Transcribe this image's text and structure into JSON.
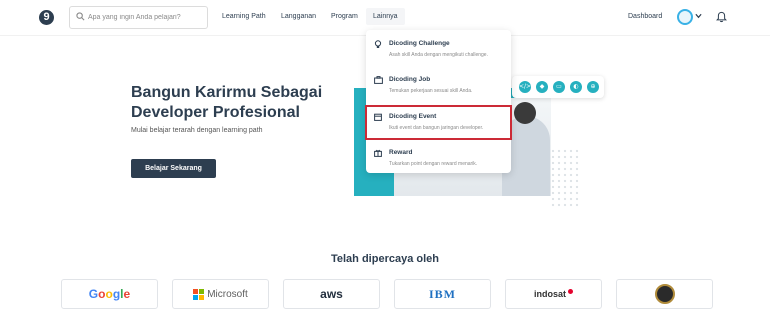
{
  "header": {
    "logo_char": "9",
    "search_placeholder": "Apa yang ingin Anda pelajari?",
    "nav": [
      "Learning Path",
      "Langganan",
      "Program",
      "Lainnya"
    ],
    "dashboard": "Dashboard"
  },
  "hero": {
    "title_line1": "Bangun Karirmu Sebagai",
    "title_line2": "Developer Profesional",
    "subtitle": "Mulai belajar terarah dengan learning path",
    "cta": "Belajar Sekarang",
    "tech_icons": [
      "code-icon",
      "cube-icon",
      "vr-icon",
      "android-icon",
      "globe-icon"
    ]
  },
  "dropdown": {
    "items": [
      {
        "title": "Dicoding Challenge",
        "desc": "Asah skill Anda dengan mengikuti challenge.",
        "icon": "bulb-icon"
      },
      {
        "title": "Dicoding Job",
        "desc": "Temukan pekerjaan sesuai skill Anda.",
        "icon": "briefcase-icon"
      },
      {
        "title": "Dicoding Event",
        "desc": "Ikuti event dan bangun jaringan developer.",
        "icon": "calendar-icon"
      },
      {
        "title": "Reward",
        "desc": "Tukarkan point dengan reward menarik.",
        "icon": "gift-icon"
      }
    ],
    "highlighted_index": 2
  },
  "trusted": {
    "title": "Telah dipercaya oleh",
    "partners": [
      "Google",
      "Microsoft",
      "aws",
      "IBM",
      "indosat",
      "government-seal"
    ]
  },
  "colors": {
    "primary": "#2d3e50",
    "accent": "#26b0bf",
    "highlight": "#cc2a36"
  }
}
